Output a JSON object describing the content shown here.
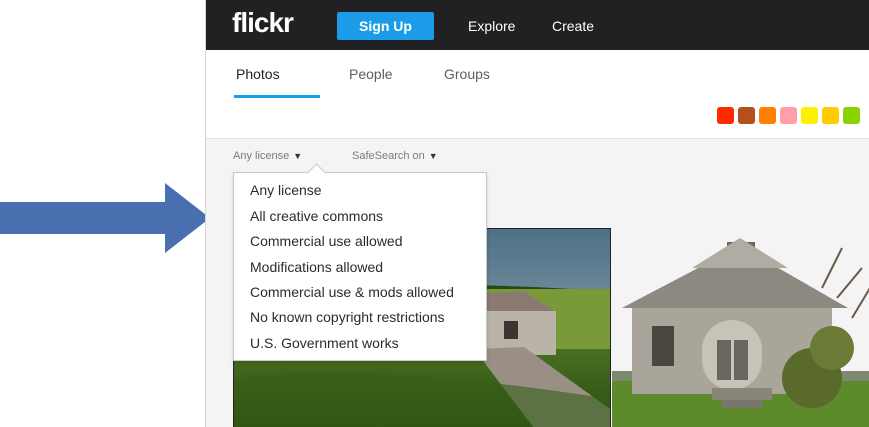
{
  "header": {
    "logo": "flickr",
    "signup_label": "Sign Up",
    "nav": [
      "Explore",
      "Create"
    ]
  },
  "tabs": [
    {
      "label": "Photos",
      "active": true
    },
    {
      "label": "People",
      "active": false
    },
    {
      "label": "Groups",
      "active": false
    }
  ],
  "color_swatches": [
    "#ff2a00",
    "#b5501c",
    "#ff7f00",
    "#ffa0a8",
    "#fff000",
    "#ffcc00",
    "#88d400"
  ],
  "filters": {
    "license_label": "Any license",
    "safesearch_label": "SafeSearch on"
  },
  "license_menu": {
    "items": [
      "Any license",
      "All creative commons",
      "Commercial use allowed",
      "Modifications allowed",
      "Commercial use & mods allowed",
      "No known copyright restrictions",
      "U.S. Government works"
    ]
  },
  "accent_colors": {
    "brand_blue": "#1c9be9",
    "topbar": "#212124",
    "arrow": "#4a6fb1"
  }
}
